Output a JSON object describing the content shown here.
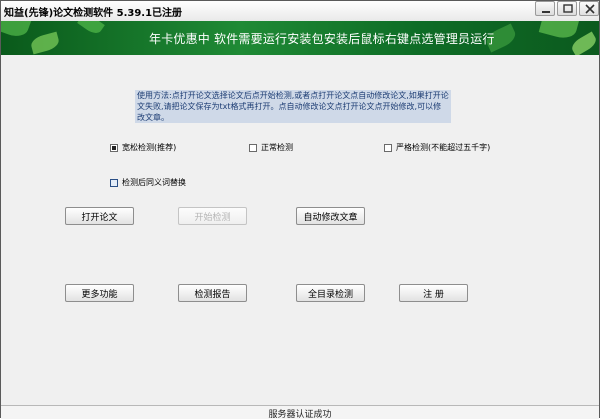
{
  "window": {
    "title": "知益(先锋)论文检测软件 5.39.1已注册"
  },
  "banner": {
    "text": "年卡优惠中 软件需要运行安装包安装后鼠标右键点选管理员运行"
  },
  "instructions": {
    "text": "使用方法:点打开论文选择论文后点开始检测,或者点打开论文点自动修改论文,如果打开论文失败,请把论文保存为txt格式再打开。点自动修改论文点打开论文点开始修改,可以修改文章。"
  },
  "modes": [
    {
      "label": "宽松检测(推荐)",
      "checked": true
    },
    {
      "label": "正常检测",
      "checked": false
    },
    {
      "label": "严格检测(不能超过五千字)",
      "checked": false
    }
  ],
  "synonym_option": {
    "label": "检测后同义词替换",
    "checked": false
  },
  "buttons": {
    "open_paper": "打开论文",
    "start_check": "开始检测",
    "auto_modify": "自动修改文章",
    "more": "更多功能",
    "report": "检测报告",
    "full_catalog": "全目录检测",
    "register": "注 册"
  },
  "status": {
    "text": "服务器认证成功"
  }
}
